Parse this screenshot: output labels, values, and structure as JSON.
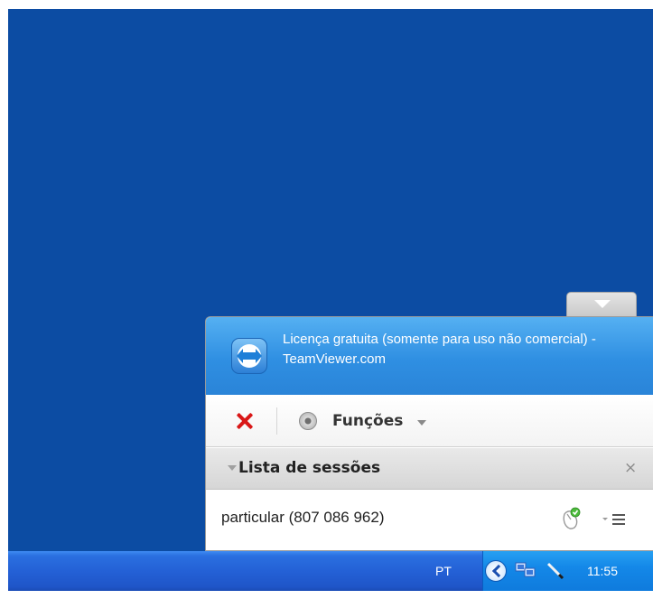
{
  "desktop": {
    "background": "#0c4ca3"
  },
  "teamviewer": {
    "license_text": "Licença gratuita (somente para uso não comercial) - TeamViewer.com",
    "toolbar": {
      "functions_label": "Funções"
    },
    "sessions": {
      "title": "Lista de sessões",
      "close_glyph": "×",
      "items": [
        {
          "name": "particular (807 086 962)"
        }
      ]
    },
    "accent": "#2f8fe2"
  },
  "taskbar": {
    "language": "PT",
    "clock": "11:55",
    "tray_icons": [
      "chevron-left-icon",
      "network-icon",
      "pen-icon"
    ]
  }
}
